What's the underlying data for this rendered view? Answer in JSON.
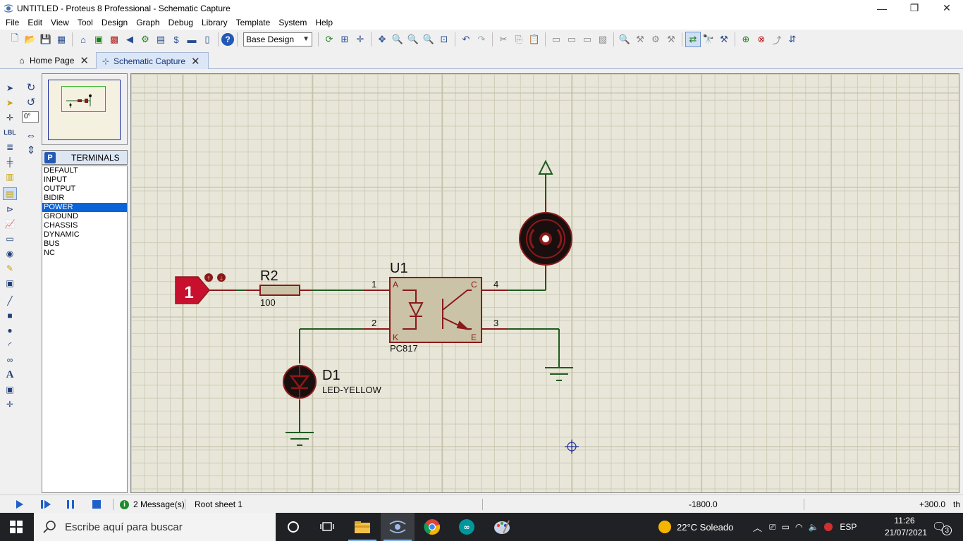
{
  "window": {
    "title": "UNTITLED - Proteus 8 Professional - Schematic Capture",
    "minimize_glyph": "—",
    "maximize_glyph": "❐",
    "close_glyph": "✕"
  },
  "menu": [
    "File",
    "Edit",
    "View",
    "Tool",
    "Design",
    "Graph",
    "Debug",
    "Library",
    "Template",
    "System",
    "Help"
  ],
  "toolbar": {
    "design_select": "Base Design"
  },
  "tabs": [
    {
      "label": "Home Page",
      "close": "✕"
    },
    {
      "label": "Schematic Capture",
      "close": "✕"
    }
  ],
  "left_panel": {
    "angle_value": "0°",
    "panel_mode": "P",
    "panel_title": "TERMINALS",
    "terminals": [
      "DEFAULT",
      "INPUT",
      "OUTPUT",
      "BIDIR",
      "POWER",
      "GROUND",
      "CHASSIS",
      "DYNAMIC",
      "BUS",
      "NC"
    ],
    "selected_terminal": "POWER"
  },
  "schematic": {
    "logic_state": "1",
    "resistor": {
      "ref": "R2",
      "value": "100"
    },
    "optocoupler": {
      "ref": "U1",
      "part": "PC817",
      "pins": {
        "A": "A",
        "K": "K",
        "C": "C",
        "E": "E"
      },
      "pin_numbers": [
        "1",
        "2",
        "3",
        "4"
      ]
    },
    "led": {
      "ref": "D1",
      "part": "LED-YELLOW"
    },
    "colors": {
      "wire": "#1f5a1f",
      "component": "#8a1a1a",
      "body": "#cbc3a8",
      "logic": "#c8102e"
    }
  },
  "statusbar": {
    "messages": "2 Message(s)",
    "sheet": "Root sheet 1",
    "x_coord": "-1800.0",
    "y_coord": "+300.0",
    "units": "th"
  },
  "taskbar": {
    "search_placeholder": "Escribe aquí para buscar",
    "weather": "22°C  Soleado",
    "language": "ESP",
    "time": "11:26",
    "date": "21/07/2021",
    "notifications": "3"
  }
}
